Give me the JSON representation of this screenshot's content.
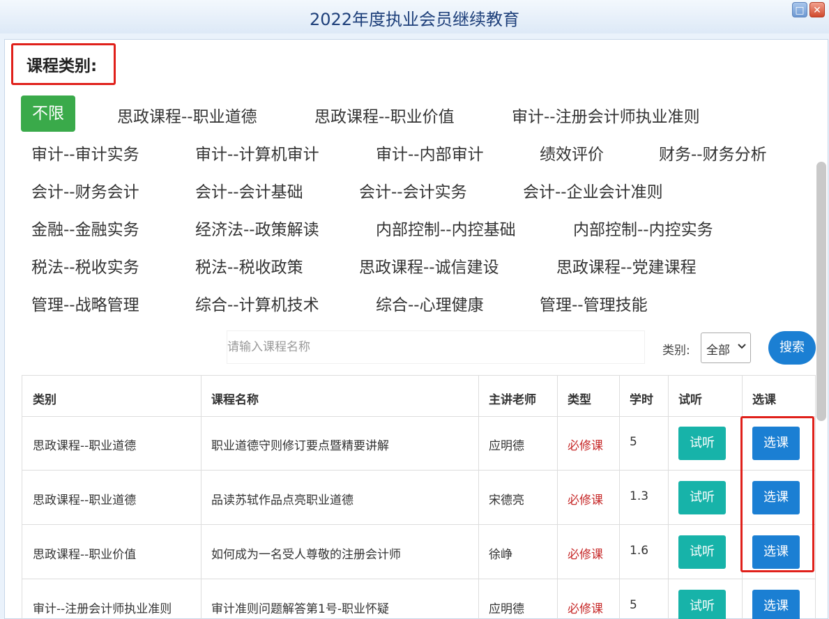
{
  "window": {
    "title": "2022年度执业会员继续教育",
    "max_icon": "restore-icon",
    "close_icon": "close-icon",
    "max_glyph": "□",
    "close_glyph": "✕"
  },
  "categories": {
    "heading": "课程类别:",
    "active": "不限",
    "items": [
      "思政课程--职业道德",
      "思政课程--职业价值",
      "审计--注册会计师执业准则",
      "审计--审计实务",
      "审计--计算机审计",
      "审计--内部审计",
      "绩效评价",
      "财务--财务分析",
      "会计--财务会计",
      "会计--会计基础",
      "会计--会计实务",
      "会计--企业会计准则",
      "金融--金融实务",
      "经济法--政策解读",
      "内部控制--内控基础",
      "内部控制--内控实务",
      "税法--税收实务",
      "税法--税收政策",
      "思政课程--诚信建设",
      "思政课程--党建课程",
      "管理--战略管理",
      "综合--计算机技术",
      "综合--心理健康",
      "管理--管理技能"
    ]
  },
  "search": {
    "placeholder": "请输入课程名称",
    "value": "",
    "type_label": "类别:",
    "type_value": "全部",
    "button": "搜索"
  },
  "table": {
    "headers": [
      "类别",
      "课程名称",
      "主讲老师",
      "类型",
      "学时",
      "试听",
      "选课"
    ],
    "rows": [
      {
        "category": "思政课程--职业道德",
        "name": "职业道德守则修订要点暨精要讲解",
        "teacher": "应明德",
        "type": "必修课",
        "hours": "5",
        "try": "试听",
        "select": "选课"
      },
      {
        "category": "思政课程--职业道德",
        "name": "品读苏轼作品点亮职业道德",
        "teacher": "宋德亮",
        "type": "必修课",
        "hours": "1.3",
        "try": "试听",
        "select": "选课"
      },
      {
        "category": "思政课程--职业价值",
        "name": "如何成为一名受人尊敬的注册会计师",
        "teacher": "徐峥",
        "type": "必修课",
        "hours": "1.6",
        "try": "试听",
        "select": "选课"
      },
      {
        "category": "审计--注册会计师执业准则",
        "name": "审计准则问题解答第1号-职业怀疑",
        "teacher": "应明德",
        "type": "必修课",
        "hours": "5",
        "try": "试听",
        "select": "选课"
      }
    ]
  },
  "colors": {
    "active_green": "#3aaa4a",
    "primary_blue": "#1b7fd3",
    "teal": "#17b3a9",
    "required_red": "#c62828",
    "highlight_red": "#e0201a"
  }
}
